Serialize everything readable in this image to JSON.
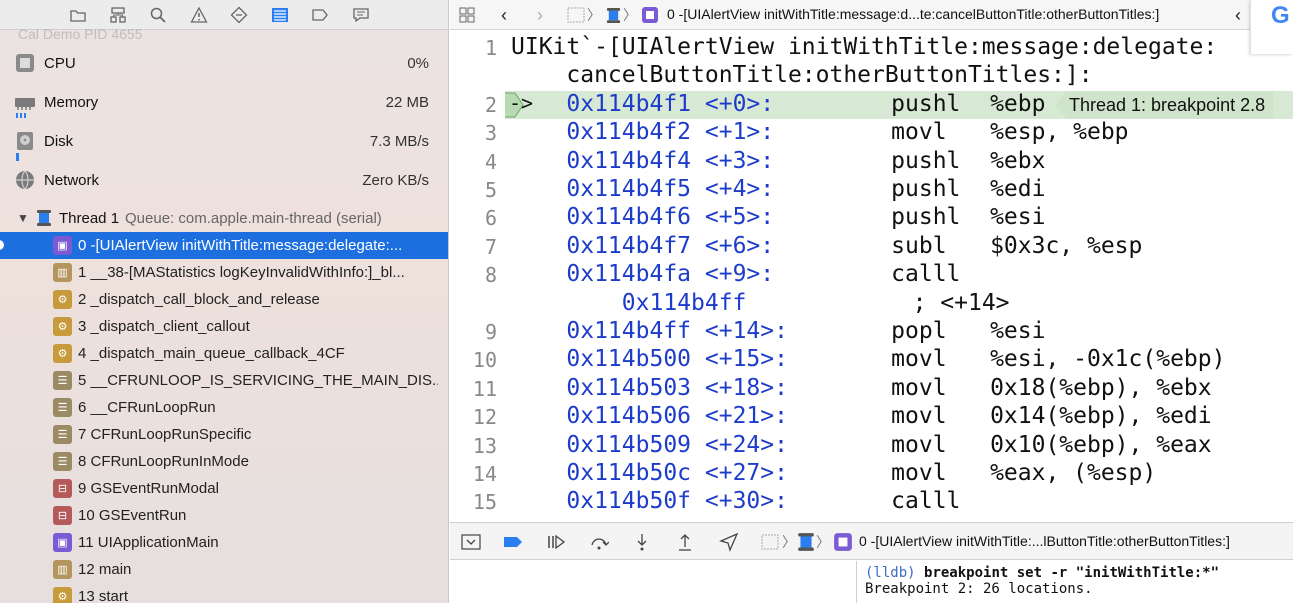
{
  "navigator": {
    "toolbar_icons": [
      "folder-icon",
      "hierarchy-icon",
      "search-icon",
      "warning-icon",
      "test-diamond-icon",
      "debug-list-icon",
      "tag-icon",
      "message-icon"
    ],
    "hidden_row_text": "Cal Demo  PID 4655",
    "gauges": [
      {
        "label": "CPU",
        "value": "0%",
        "icon": "cpu-icon",
        "level": 0
      },
      {
        "label": "Memory",
        "value": "22 MB",
        "icon": "memory-icon",
        "level": 0.3
      },
      {
        "label": "Disk",
        "value": "7.3 MB/s",
        "icon": "disk-icon",
        "level": 0.2
      },
      {
        "label": "Network",
        "value": "Zero KB/s",
        "icon": "network-icon",
        "level": 0
      }
    ],
    "thread": {
      "name": "Thread 1",
      "queue": "Queue: com.apple.main-thread (serial)"
    },
    "frames": [
      {
        "label": "0 -[UIAlertView initWithTitle:message:delegate:...",
        "color": "#7a5bd3",
        "selected": true
      },
      {
        "label": "1 __38-[MAStatistics logKeyInvalidWithInfo:]_bl...",
        "color": "#b4955e",
        "selected": false
      },
      {
        "label": "2 _dispatch_call_block_and_release",
        "color": "#c79a3c",
        "selected": false
      },
      {
        "label": "3 _dispatch_client_callout",
        "color": "#c79a3c",
        "selected": false
      },
      {
        "label": "4 _dispatch_main_queue_callback_4CF",
        "color": "#c79a3c",
        "selected": false
      },
      {
        "label": "5 __CFRUNLOOP_IS_SERVICING_THE_MAIN_DIS...",
        "color": "#9b8b65",
        "selected": false
      },
      {
        "label": "6 __CFRunLoopRun",
        "color": "#9b8b65",
        "selected": false
      },
      {
        "label": "7 CFRunLoopRunSpecific",
        "color": "#9b8b65",
        "selected": false
      },
      {
        "label": "8 CFRunLoopRunInMode",
        "color": "#9b8b65",
        "selected": false
      },
      {
        "label": "9 GSEventRunModal",
        "color": "#b55a5a",
        "selected": false
      },
      {
        "label": "10 GSEventRun",
        "color": "#b55a5a",
        "selected": false
      },
      {
        "label": "11 UIApplicationMain",
        "color": "#7a5bd3",
        "selected": false
      },
      {
        "label": "12 main",
        "color": "#b4955e",
        "selected": false
      },
      {
        "label": "13 start",
        "color": "#c79a3c",
        "selected": false
      }
    ]
  },
  "jump_bar": {
    "title": "0 -[UIAlertView initWithTitle:message:d...te:cancelButtonTitle:otherButtonTitles:]"
  },
  "google_badge": "G",
  "code": {
    "lines": [
      {
        "num": "1",
        "text": "UIKit`-[UIAlertView initWithTitle:message:delegate:",
        "kind": "header"
      },
      {
        "num": "",
        "text": "    cancelButtonTitle:otherButtonTitles:]:",
        "kind": "header"
      },
      {
        "num": "2",
        "addr": "0x114b4f1",
        "off": "<+0>:",
        "op": "pushl",
        "args": "%ebp",
        "kind": "instr",
        "current": true
      },
      {
        "num": "3",
        "addr": "0x114b4f2",
        "off": "<+1>:",
        "op": "movl",
        "args": "%esp, %ebp",
        "kind": "instr"
      },
      {
        "num": "4",
        "addr": "0x114b4f4",
        "off": "<+3>:",
        "op": "pushl",
        "args": "%ebx",
        "kind": "instr"
      },
      {
        "num": "5",
        "addr": "0x114b4f5",
        "off": "<+4>:",
        "op": "pushl",
        "args": "%edi",
        "kind": "instr"
      },
      {
        "num": "6",
        "addr": "0x114b4f6",
        "off": "<+5>:",
        "op": "pushl",
        "args": "%esi",
        "kind": "instr"
      },
      {
        "num": "7",
        "addr": "0x114b4f7",
        "off": "<+6>:",
        "op": "subl",
        "args": "$0x3c, %esp",
        "kind": "instr"
      },
      {
        "num": "8",
        "addr": "0x114b4fa",
        "off": "<+9>:",
        "op": "calll",
        "args": "",
        "kind": "instr"
      },
      {
        "num": "",
        "text": "        0x114b4ff",
        "comment": "; <+14>",
        "kind": "cont"
      },
      {
        "num": "9",
        "addr": "0x114b4ff",
        "off": "<+14>:",
        "op": "popl",
        "args": "%esi",
        "kind": "instr"
      },
      {
        "num": "10",
        "addr": "0x114b500",
        "off": "<+15>:",
        "op": "movl",
        "args": "%esi, -0x1c(%ebp)",
        "kind": "instr"
      },
      {
        "num": "11",
        "addr": "0x114b503",
        "off": "<+18>:",
        "op": "movl",
        "args": "0x18(%ebp), %ebx",
        "kind": "instr"
      },
      {
        "num": "12",
        "addr": "0x114b506",
        "off": "<+21>:",
        "op": "movl",
        "args": "0x14(%ebp), %edi",
        "kind": "instr"
      },
      {
        "num": "13",
        "addr": "0x114b509",
        "off": "<+24>:",
        "op": "movl",
        "args": "0x10(%ebp), %eax",
        "kind": "instr"
      },
      {
        "num": "14",
        "addr": "0x114b50c",
        "off": "<+27>:",
        "op": "movl",
        "args": "%eax, (%esp)",
        "kind": "instr"
      },
      {
        "num": "15",
        "addr": "0x114b50f",
        "off": "<+30>:",
        "op": "calll",
        "args": "",
        "kind": "instr"
      }
    ],
    "breakpoint_badge": "Thread 1: breakpoint 2.8"
  },
  "debug_bar": {
    "icons": [
      "hide-debug-area-icon",
      "breakpoints-toggle-icon",
      "continue-icon",
      "step-over-icon",
      "step-into-icon",
      "step-out-icon",
      "simulate-location-icon"
    ],
    "title": "0 -[UIAlertView initWithTitle:...lButtonTitle:otherButtonTitles:]"
  },
  "console": {
    "prompt": "(lldb)",
    "command": "breakpoint set -r \"initWithTitle:*\"",
    "output": "Breakpoint 2: 26 locations."
  },
  "colors": {
    "selection": "#1d6fe0",
    "address": "#1c3cc9",
    "current_line": "#d7e9d5",
    "accent": "#2a7ef0"
  }
}
